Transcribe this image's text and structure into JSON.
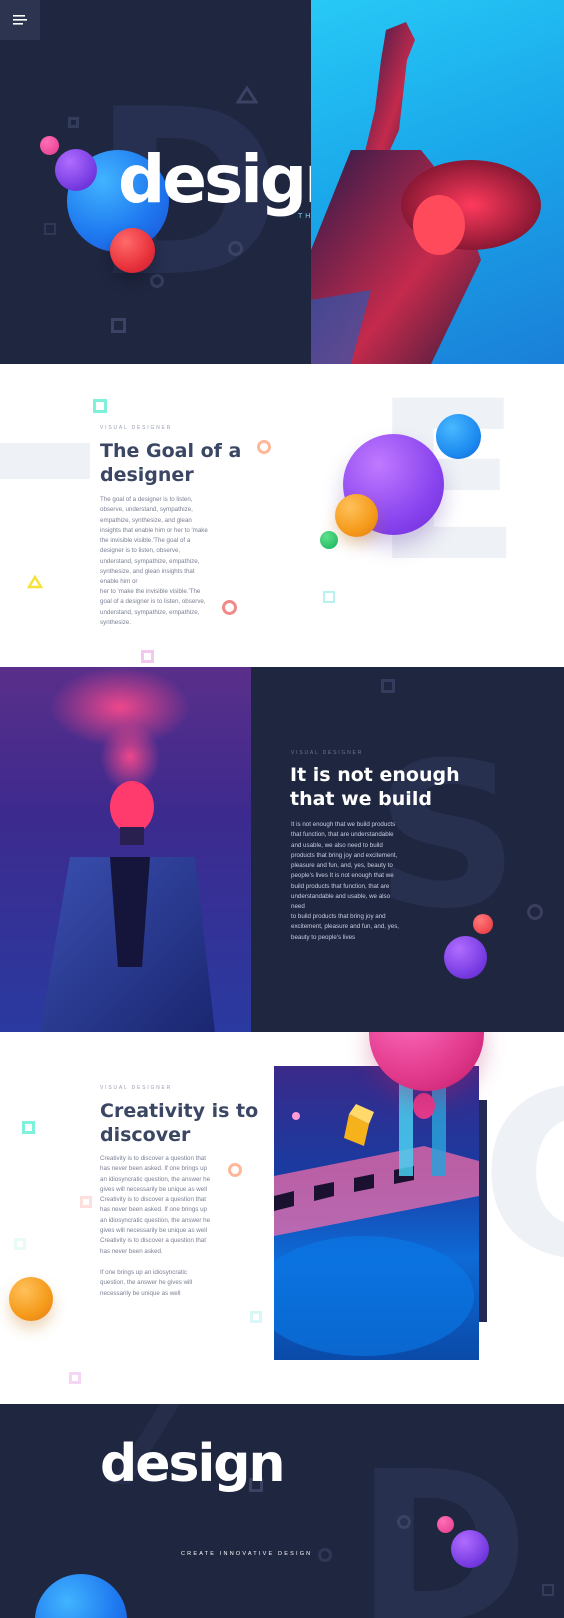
{
  "hero": {
    "title": "design",
    "subtitle": "THINKING",
    "bg_letter": "D"
  },
  "section1": {
    "eyebrow": "VISUAL DESIGNER",
    "heading_line1": "The Goal of a",
    "heading_line2": "designer",
    "paragraph1": "The goal of a designer is to listen, observe, understand, sympathize, empathize, synthesize, and glean insights that enable him or her to 'make the invisible visible.'The goal of a designer is to listen, observe, understand, sympathize, empathize, synthesize, and glean insights that enable him or",
    "paragraph2": "her to 'make the invisible visible.'The goal of a designer is to listen, observe, understand, sympathize, empathize, synthesize.",
    "bg_letter": "E"
  },
  "section2": {
    "eyebrow": "VISUAL DESIGNER",
    "heading_line1": "It is not enough",
    "heading_line2": "that we build",
    "paragraph1": "It is not enough that we build products that function, that are understandable and usable, we also need to build products that bring joy and excitement, pleasure and fun, and, yes, beauty to people's lives It is not enough that we build products that function, that are understandable and usable, we also need",
    "paragraph2": " to build products that bring joy and excitement, pleasure and fun, and, yes, beauty to people's lives",
    "bg_letter": "S"
  },
  "section3": {
    "eyebrow": "VISUAL DESIGNER",
    "heading_line1": "Creativity is to",
    "heading_line2": "discover",
    "paragraph1": "Creativity is to discover a question that has never been asked. If one brings up an idiosyncratic question, the answer he gives will necessarily be unique as well Creativity is to discover a question that has never been asked. If one brings up an idiosyncratic question, the answer he gives will necessarily be unique as well Creativity is to discover a question that has never been asked.",
    "paragraph2": "If one brings up an idiosyncratic question, the answer he gives will necessarily be unique as well",
    "bg_letter": "G"
  },
  "footer": {
    "title": "design",
    "tagline": "CREATE INNOVATIVE DESIGN",
    "bg_letter": "D"
  },
  "icons": {
    "menu": "hamburger-menu-icon"
  },
  "colors": {
    "navy": "#1f2640",
    "heading_dark": "#33405e",
    "accent_pink": "#e23a8c",
    "accent_purple": "#7b3fe4",
    "accent_blue": "#1e8cf0",
    "accent_orange": "#f59a1a",
    "accent_red": "#e8323c"
  }
}
